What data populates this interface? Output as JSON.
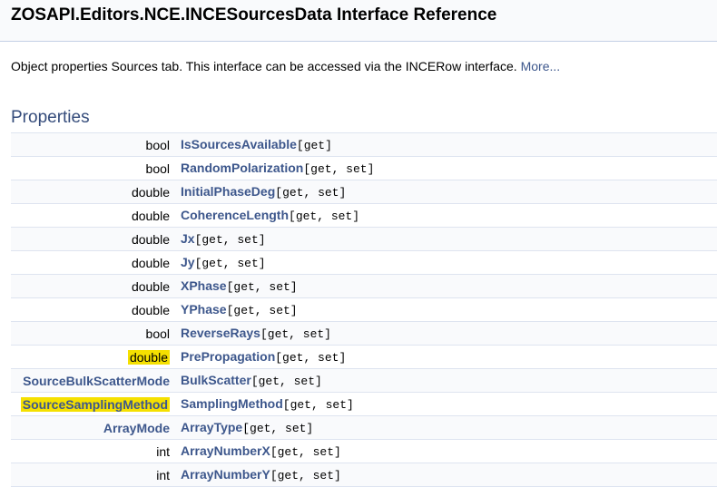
{
  "header": {
    "title": "ZOSAPI.Editors.NCE.INCESourcesData Interface Reference"
  },
  "brief": {
    "text": "Object properties Sources tab. This interface can be accessed via the INCERow interface.",
    "more_link": "More..."
  },
  "section": {
    "title": "Properties"
  },
  "properties": [
    {
      "type": "bool",
      "name": "IsSourcesAvailable",
      "access": "[get]"
    },
    {
      "type": "bool",
      "name": "RandomPolarization",
      "access": "[get, set]"
    },
    {
      "type": "double",
      "name": "InitialPhaseDeg",
      "access": "[get, set]"
    },
    {
      "type": "double",
      "name": "CoherenceLength",
      "access": "[get, set]"
    },
    {
      "type": "double",
      "name": "Jx",
      "access": "[get, set]"
    },
    {
      "type": "double",
      "name": "Jy",
      "access": "[get, set]"
    },
    {
      "type": "double",
      "name": "XPhase",
      "access": "[get, set]"
    },
    {
      "type": "double",
      "name": "YPhase",
      "access": "[get, set]"
    },
    {
      "type": "bool",
      "name": "ReverseRays",
      "access": "[get, set]"
    },
    {
      "type": "double",
      "name": "PrePropagation",
      "access": "[get, set]"
    },
    {
      "type": "SourceBulkScatterMode",
      "name": "BulkScatter",
      "access": "[get, set]"
    },
    {
      "type": "SourceSamplingMethod",
      "name": "SamplingMethod",
      "access": "[get, set]"
    },
    {
      "type": "ArrayMode",
      "name": "ArrayType",
      "access": "[get, set]"
    },
    {
      "type": "int",
      "name": "ArrayNumberX",
      "access": "[get, set]"
    },
    {
      "type": "int",
      "name": "ArrayNumberY",
      "access": "[get, set]"
    }
  ]
}
